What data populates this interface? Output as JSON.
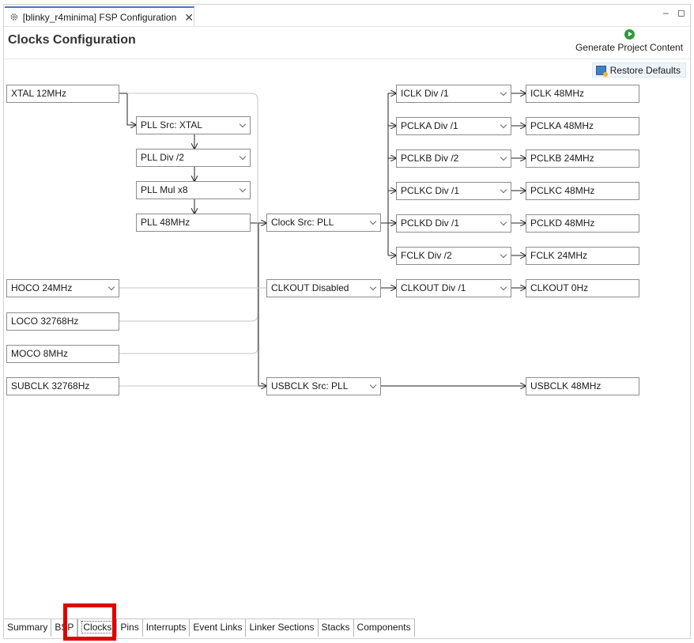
{
  "editor_tab": {
    "title": "[blinky_r4minima] FSP Configuration",
    "icon": "gear-icon",
    "close_icon": "close-icon"
  },
  "window_controls": {
    "minimize": "–",
    "maximize": "◻"
  },
  "page_title": "Clocks Configuration",
  "toolbar": {
    "generate_label": "Generate Project Content",
    "generate_icon": "play-circle-icon",
    "restore_label": "Restore Defaults",
    "restore_icon": "restore-defaults-icon"
  },
  "sources": {
    "xtal": "XTAL 12MHz",
    "hoco": "HOCO 24MHz",
    "loco": "LOCO 32768Hz",
    "moco": "MOCO 8MHz",
    "subclk": "SUBCLK 32768Hz"
  },
  "pll": {
    "src": "PLL Src: XTAL",
    "div": "PLL Div /2",
    "mul": "PLL Mul x8",
    "out": "PLL 48MHz"
  },
  "clock_src": "Clock Src: PLL",
  "clkout_src": "CLKOUT Disabled",
  "usbclk_src": "USBCLK Src: PLL",
  "dividers": {
    "iclk": "ICLK Div /1",
    "pclka": "PCLKA Div /1",
    "pclkb": "PCLKB Div /2",
    "pclkc": "PCLKC Div /1",
    "pclkd": "PCLKD Div /1",
    "fclk": "FCLK Div /2",
    "clkout": "CLKOUT Div /1"
  },
  "outputs": {
    "iclk": "ICLK 48MHz",
    "pclka": "PCLKA 48MHz",
    "pclkb": "PCLKB 24MHz",
    "pclkc": "PCLKC 48MHz",
    "pclkd": "PCLKD 48MHz",
    "fclk": "FCLK 24MHz",
    "clkout": "CLKOUT 0Hz",
    "usbclk": "USBCLK 48MHz"
  },
  "bottom_tabs": [
    "Summary",
    "BSP",
    "Clocks",
    "Pins",
    "Interrupts",
    "Event Links",
    "Linker Sections",
    "Stacks",
    "Components"
  ],
  "active_tab": "Clocks",
  "colors": {
    "tab_accent": "#3d7bc8",
    "highlight": "#e00000",
    "generate_green": "#2f9a3a"
  }
}
